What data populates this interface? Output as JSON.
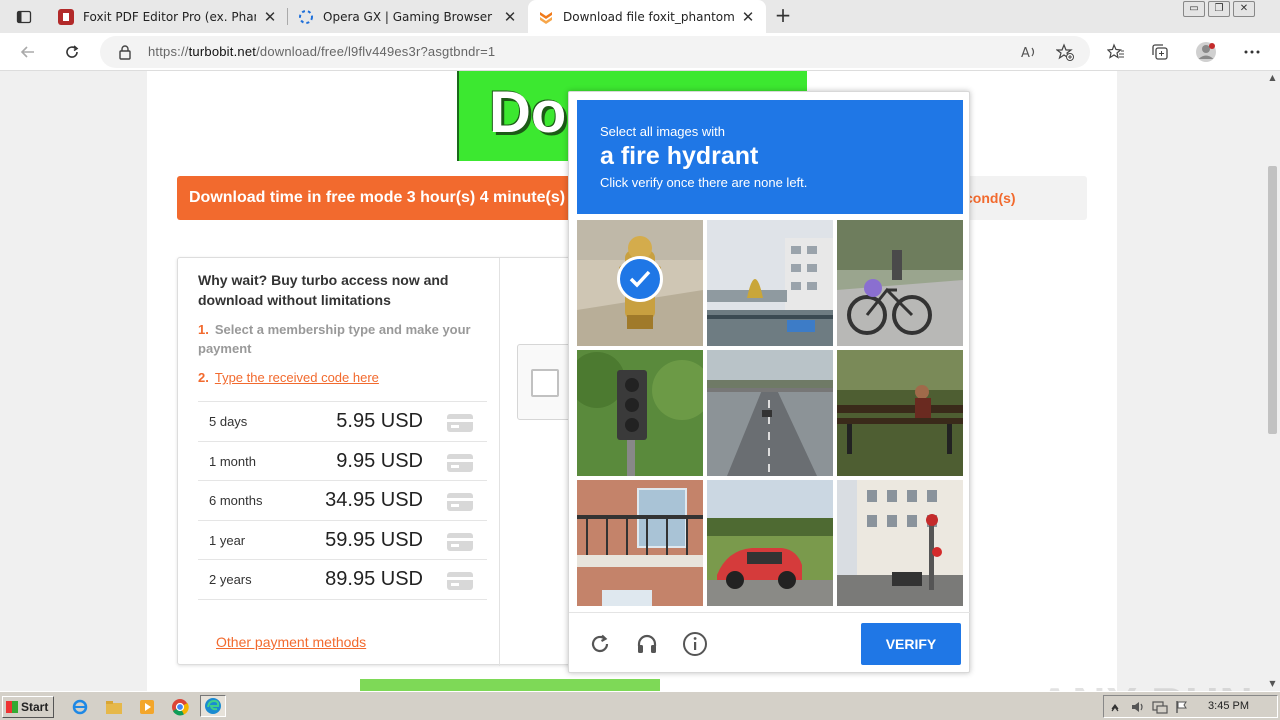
{
  "browser": {
    "tabs": [
      {
        "title": "Foxit PDF Editor Pro (ex. Phantom",
        "favicon_color": "#b22a2a"
      },
      {
        "title": "Opera GX | Gaming Browser | Op",
        "favicon_color": "#1e6fd9"
      },
      {
        "title": "Download file foxit_phantompdf_",
        "favicon_color": "#f07a1a",
        "active": true
      }
    ],
    "new_tab_symbol": "+",
    "url_prefix": "https://",
    "url_host": "turbobit.net",
    "url_path": "/download/free/l9flv449es3r?asgtbndr=1",
    "window_controls": [
      "▭",
      "❐",
      "✕"
    ]
  },
  "page": {
    "banner_text": "Do",
    "timer_text": "Download time in free mode 3 hour(s) 4 minute(s)",
    "timer_tail": "cond(s)",
    "buy_heading": "Why wait? Buy turbo access now and download without limitations",
    "step1_num": "1.",
    "step1_text": "Select a membership type and make your payment",
    "step2_num": "2.",
    "step2_link": "Type the received code here",
    "prices": [
      {
        "duration": "5 days",
        "amount": "5.95 USD"
      },
      {
        "duration": "1 month",
        "amount": "9.95 USD"
      },
      {
        "duration": "6 months",
        "amount": "34.95 USD"
      },
      {
        "duration": "1 year",
        "amount": "59.95 USD"
      },
      {
        "duration": "2 years",
        "amount": "89.95 USD"
      }
    ],
    "other_payment": "Other payment methods"
  },
  "captcha": {
    "line1": "Select all images with",
    "line2": "a fire hydrant",
    "line3": "Click verify once there are none left.",
    "verify_label": "VERIFY",
    "accent": "#1f77e6",
    "tiles": [
      {
        "subject": "fire hydrant",
        "selected": true
      },
      {
        "subject": "building by bridge",
        "selected": false
      },
      {
        "subject": "bicycle on street",
        "selected": false
      },
      {
        "subject": "traffic light",
        "selected": false
      },
      {
        "subject": "highway",
        "selected": false
      },
      {
        "subject": "park bench",
        "selected": false
      },
      {
        "subject": "balcony",
        "selected": false
      },
      {
        "subject": "red car",
        "selected": false
      },
      {
        "subject": "street with signal",
        "selected": false
      }
    ]
  },
  "watermark": "ANY RUN",
  "taskbar": {
    "start_label": "Start",
    "clock": "3:45 PM"
  }
}
